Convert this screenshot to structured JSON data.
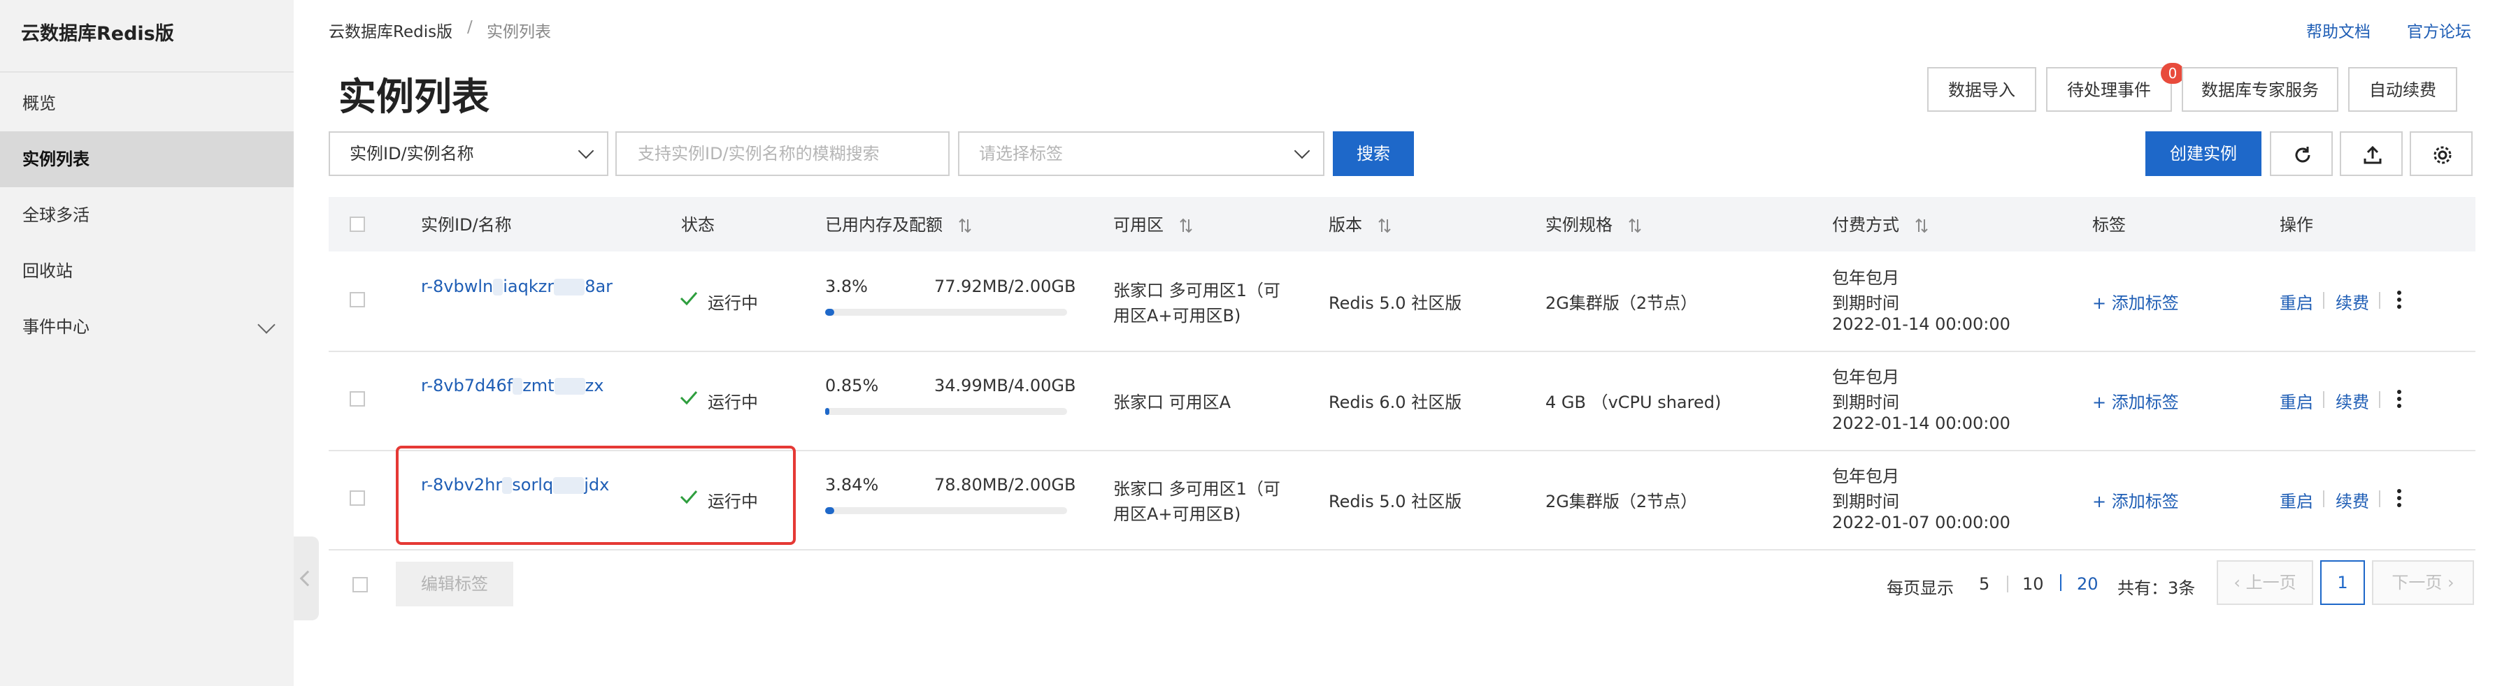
{
  "sidebar": {
    "title": "云数据库Redis版",
    "items": [
      {
        "label": "概览"
      },
      {
        "label": "实例列表"
      },
      {
        "label": "全球多活"
      },
      {
        "label": "回收站"
      },
      {
        "label": "事件中心"
      }
    ]
  },
  "breadcrumb": {
    "root": "云数据库Redis版",
    "sep": "/",
    "current": "实例列表"
  },
  "top_links": {
    "help": "帮助文档",
    "forum": "官方论坛"
  },
  "page_title": "实例列表",
  "actions": {
    "import": "数据导入",
    "pending": "待处理事件",
    "pending_count": "0",
    "expert": "数据库专家服务",
    "auto_renew": "自动续费",
    "create": "创建实例"
  },
  "filters": {
    "field_select": "实例ID/实例名称",
    "search_placeholder": "支持实例ID/实例名称的模糊搜索",
    "tag_placeholder": "请选择标签",
    "search_button": "搜索"
  },
  "table": {
    "headers": {
      "id": "实例ID/名称",
      "status": "状态",
      "memory": "已用内存及配额",
      "zone": "可用区",
      "version": "版本",
      "spec": "实例规格",
      "billing": "付费方式",
      "tags": "标签",
      "ops": "操作"
    },
    "rows": [
      {
        "id_a": "r-8vbwln",
        "id_b": "iaqkzr",
        "id_c": "8ar",
        "status": "运行中",
        "mem_pct": "3.8%",
        "mem_used": "77.92MB/2.00GB",
        "mem_fill": 0.038,
        "zone_l1": "张家口 多可用区1（可",
        "zone_l2": "用区A+可用区B)",
        "version": "Redis 5.0 社区版",
        "spec": "2G集群版（2节点）",
        "bill_l1": "包年包月",
        "bill_l2": "到期时间",
        "bill_l3": "2022-01-14 00:00:00",
        "add_tag": "添加标签",
        "restart": "重启",
        "renew": "续费"
      },
      {
        "id_a": "r-8vb7d46f",
        "id_b": "zmt",
        "id_c": "zx",
        "status": "运行中",
        "mem_pct": "0.85%",
        "mem_used": "34.99MB/4.00GB",
        "mem_fill": 0.0085,
        "zone_l1": "张家口 可用区A",
        "zone_l2": "",
        "version": "Redis 6.0 社区版",
        "spec": "4 GB （vCPU shared)",
        "bill_l1": "包年包月",
        "bill_l2": "到期时间",
        "bill_l3": "2022-01-14 00:00:00",
        "add_tag": "添加标签",
        "restart": "重启",
        "renew": "续费"
      },
      {
        "id_a": "r-8vbv2hr",
        "id_b": "sorlq",
        "id_c": "jdx",
        "status": "运行中",
        "mem_pct": "3.84%",
        "mem_used": "78.80MB/2.00GB",
        "mem_fill": 0.0384,
        "zone_l1": "张家口 多可用区1（可",
        "zone_l2": "用区A+可用区B)",
        "version": "Redis 5.0 社区版",
        "spec": "2G集群版（2节点）",
        "bill_l1": "包年包月",
        "bill_l2": "到期时间",
        "bill_l3": "2022-01-07 00:00:00",
        "add_tag": "添加标签",
        "restart": "重启",
        "renew": "续费"
      }
    ]
  },
  "footer": {
    "edit_tags": "编辑标签",
    "per_page_label": "每页显示",
    "sizes": [
      "5",
      "10",
      "20"
    ],
    "total": "共有：3条",
    "prev": "上一页",
    "current_page": "1",
    "next": "下一页"
  },
  "colors": {
    "primary": "#1e68c9",
    "link": "#1f5eb5",
    "success": "#2e9e3e",
    "danger": "#e53935"
  }
}
